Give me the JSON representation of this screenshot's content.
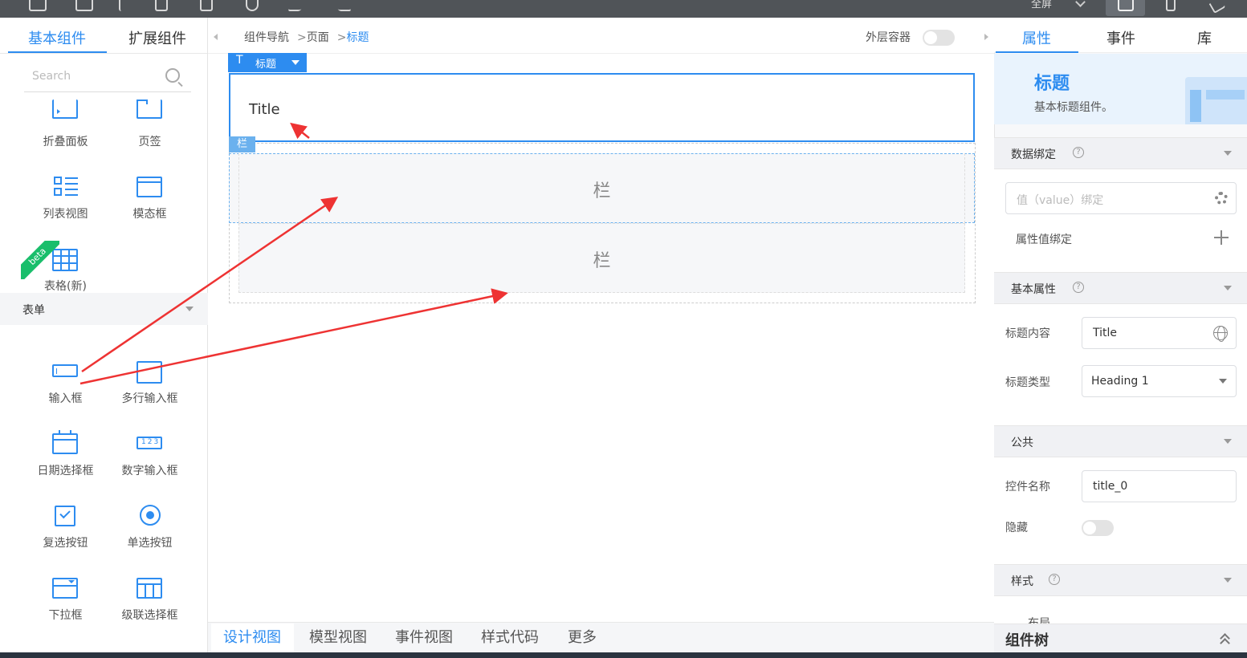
{
  "left_panel": {
    "tabs": [
      {
        "label": "基本组件"
      },
      {
        "label": "扩展组件"
      }
    ],
    "search_placeholder": "Search",
    "basic_components": [
      {
        "label": "折叠面板",
        "icon": "collapse-panel-icon"
      },
      {
        "label": "页签",
        "icon": "tabs-icon"
      },
      {
        "label": "列表视图",
        "icon": "list-view-icon"
      },
      {
        "label": "模态框",
        "icon": "modal-icon"
      },
      {
        "label": "表格(新)",
        "icon": "table-icon",
        "badge": "beta"
      }
    ],
    "form_section": {
      "label": "表单"
    },
    "form_components": [
      {
        "label": "输入框",
        "icon": "input-icon"
      },
      {
        "label": "多行输入框",
        "icon": "textarea-icon"
      },
      {
        "label": "日期选择框",
        "icon": "date-picker-icon"
      },
      {
        "label": "数字输入框",
        "icon": "number-input-icon"
      },
      {
        "label": "复选按钮",
        "icon": "checkbox-icon"
      },
      {
        "label": "单选按钮",
        "icon": "radio-icon"
      },
      {
        "label": "下拉框",
        "icon": "select-icon"
      },
      {
        "label": "级联选择框",
        "icon": "cascader-icon"
      }
    ]
  },
  "toolbar": {
    "fullscreen_label": "全屏"
  },
  "canvas": {
    "breadcrumb": [
      "组件导航",
      "页面",
      "标题"
    ],
    "outer_container_label": "外层容器",
    "title_tag_label": "标题",
    "title_text": "Title",
    "column_tag": "栏",
    "columns": [
      {
        "label": "栏"
      },
      {
        "label": "栏"
      }
    ],
    "bottom_tabs": [
      {
        "label": "设计视图"
      },
      {
        "label": "模型视图"
      },
      {
        "label": "事件视图"
      },
      {
        "label": "样式代码"
      },
      {
        "label": "更多"
      }
    ]
  },
  "right_panel": {
    "tabs": [
      {
        "label": "属性"
      },
      {
        "label": "事件"
      },
      {
        "label": "库"
      }
    ],
    "hero": {
      "title": "标题",
      "desc": "基本标题组件。"
    },
    "data_binding": {
      "label": "数据绑定",
      "value_placeholder": "值（value）绑定",
      "prop_binding_label": "属性值绑定"
    },
    "basic_props": {
      "label": "基本属性",
      "title_content_label": "标题内容",
      "title_content_value": "Title",
      "title_type_label": "标题类型",
      "title_type_value": "Heading 1"
    },
    "common": {
      "label": "公共",
      "control_name_label": "控件名称",
      "control_name_value": "title_0",
      "hidden_label": "隐藏"
    },
    "style": {
      "label": "样式",
      "layout_label": "布局"
    },
    "component_tree_label": "组件树"
  },
  "colors": {
    "accent": "#2d8cf0",
    "annotation_arrow": "#ee3333"
  }
}
